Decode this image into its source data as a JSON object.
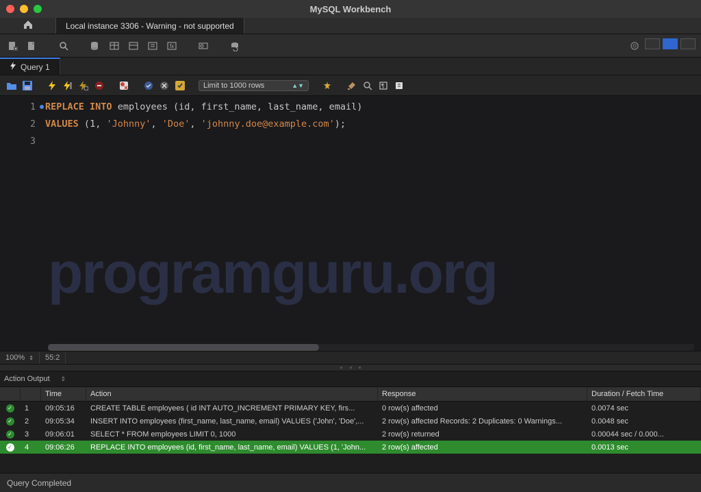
{
  "window": {
    "title": "MySQL Workbench"
  },
  "connection_tab": "Local instance 3306 - Warning - not supported",
  "query_tab": {
    "label": "Query 1"
  },
  "limit_select": "Limit to 1000 rows",
  "editor": {
    "lines": [
      "1",
      "2",
      "3"
    ],
    "code_line1_kw1": "REPLACE",
    "code_line1_kw2": "INTO",
    "code_line1_ident": "employees",
    "code_line1_cols": "(id, first_name, last_name, email)",
    "code_line2_kw": "VALUES",
    "code_line2_open": "(",
    "code_line2_num": "1",
    "code_line2_c1": ", ",
    "code_line2_s1": "'Johnny'",
    "code_line2_c2": ", ",
    "code_line2_s2": "'Doe'",
    "code_line2_c3": ", ",
    "code_line2_s3": "'johnny.doe@example.com'",
    "code_line2_close": ");"
  },
  "watermark": "programguru.org",
  "status": {
    "zoom": "100%",
    "pos": "55:2"
  },
  "output_label": "Action Output",
  "output_headers": {
    "time": "Time",
    "action": "Action",
    "response": "Response",
    "duration": "Duration / Fetch Time"
  },
  "output_rows": [
    {
      "idx": "1",
      "time": "09:05:16",
      "action": "CREATE TABLE employees (     id INT AUTO_INCREMENT PRIMARY KEY,     firs...",
      "response": "0 row(s) affected",
      "duration": "0.0074 sec"
    },
    {
      "idx": "2",
      "time": "09:05:34",
      "action": "INSERT INTO employees (first_name, last_name, email) VALUES ('John', 'Doe',...",
      "response": "2 row(s) affected Records: 2  Duplicates: 0  Warnings...",
      "duration": "0.0048 sec"
    },
    {
      "idx": "3",
      "time": "09:06:01",
      "action": "SELECT * FROM employees LIMIT 0, 1000",
      "response": "2 row(s) returned",
      "duration": "0.00044 sec / 0.000..."
    },
    {
      "idx": "4",
      "time": "09:06:26",
      "action": "REPLACE INTO employees (id, first_name, last_name, email) VALUES (1, 'John...",
      "response": "2 row(s) affected",
      "duration": "0.0013 sec"
    }
  ],
  "footer": "Query Completed"
}
